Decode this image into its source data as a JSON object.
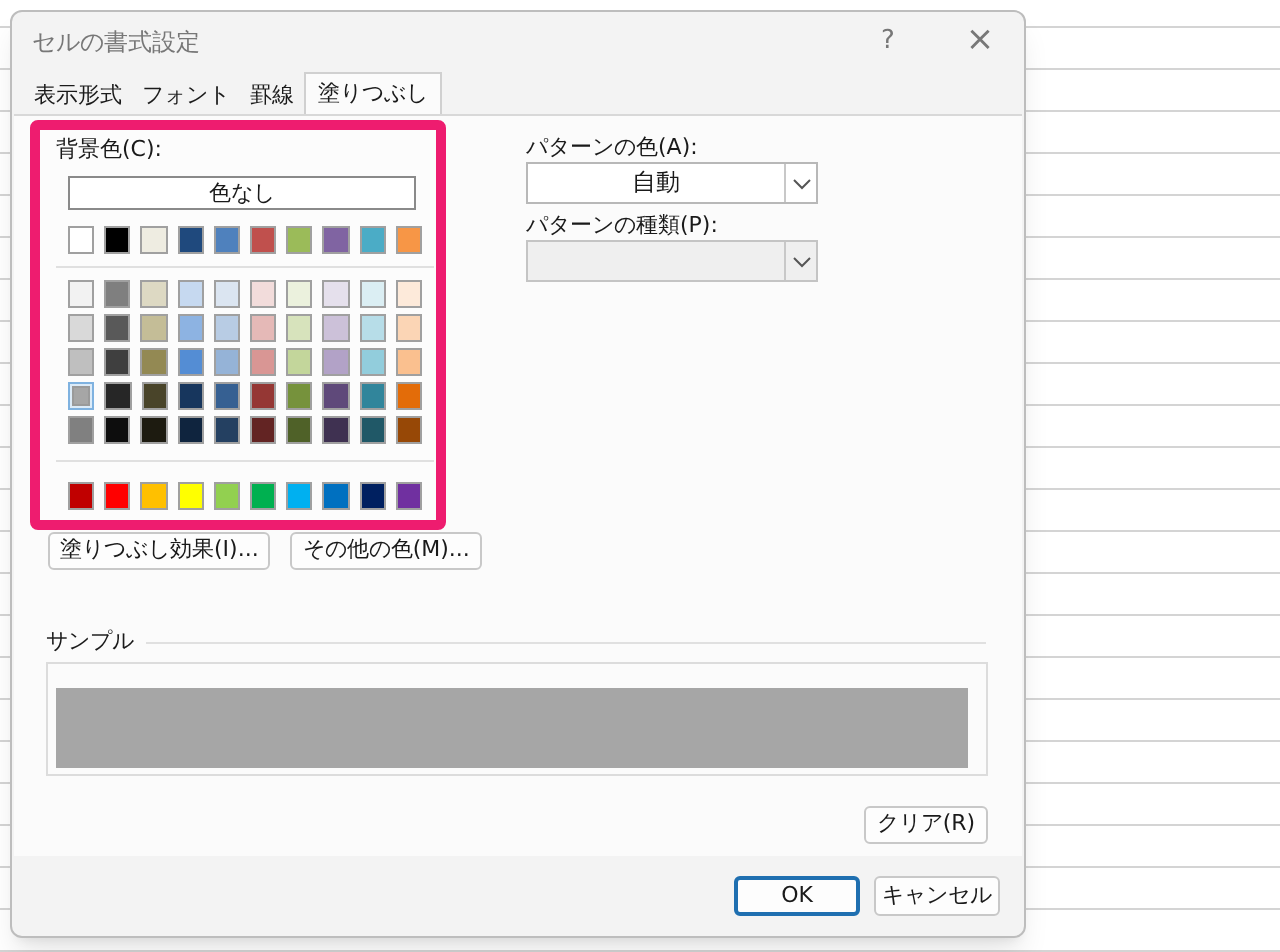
{
  "window": {
    "title": "セルの書式設定",
    "help": "?",
    "close": "×"
  },
  "tabs": [
    {
      "label": "表示形式",
      "selected": false
    },
    {
      "label": "フォント",
      "selected": false
    },
    {
      "label": "罫線",
      "selected": false
    },
    {
      "label": "塗りつぶし",
      "selected": true
    }
  ],
  "background_color": {
    "label": "背景色(C):",
    "no_color_button": "色なし",
    "theme_row": [
      {
        "color": "#ffffff",
        "selected": false
      },
      {
        "color": "#000000",
        "selected": false
      },
      {
        "color": "#eeece1",
        "selected": false
      },
      {
        "color": "#1f497d",
        "selected": false
      },
      {
        "color": "#4f81bd",
        "selected": false
      },
      {
        "color": "#c0504d",
        "selected": false
      },
      {
        "color": "#9bbb59",
        "selected": false
      },
      {
        "color": "#8064a2",
        "selected": false
      },
      {
        "color": "#4bacc6",
        "selected": false
      },
      {
        "color": "#f79646",
        "selected": false
      }
    ],
    "tint_rows": [
      [
        {
          "color": "#f2f2f2",
          "selected": false
        },
        {
          "color": "#7f7f7f",
          "selected": false
        },
        {
          "color": "#ddd9c3",
          "selected": false
        },
        {
          "color": "#c6d9f0",
          "selected": false
        },
        {
          "color": "#dbe5f1",
          "selected": false
        },
        {
          "color": "#f2dcdb",
          "selected": false
        },
        {
          "color": "#ebf1dd",
          "selected": false
        },
        {
          "color": "#e5e0ec",
          "selected": false
        },
        {
          "color": "#dbeef3",
          "selected": false
        },
        {
          "color": "#fdeada",
          "selected": false
        }
      ],
      [
        {
          "color": "#d9d9d9",
          "selected": false
        },
        {
          "color": "#595959",
          "selected": false
        },
        {
          "color": "#c4bd97",
          "selected": false
        },
        {
          "color": "#8db3e2",
          "selected": false
        },
        {
          "color": "#b8cce4",
          "selected": false
        },
        {
          "color": "#e5b9b7",
          "selected": false
        },
        {
          "color": "#d7e3bc",
          "selected": false
        },
        {
          "color": "#ccc1d9",
          "selected": false
        },
        {
          "color": "#b7dde8",
          "selected": false
        },
        {
          "color": "#fbd5b5",
          "selected": false
        }
      ],
      [
        {
          "color": "#bfbfbf",
          "selected": false
        },
        {
          "color": "#3f3f3f",
          "selected": false
        },
        {
          "color": "#938953",
          "selected": false
        },
        {
          "color": "#548dd4",
          "selected": false
        },
        {
          "color": "#95b3d7",
          "selected": false
        },
        {
          "color": "#d99694",
          "selected": false
        },
        {
          "color": "#c3d69b",
          "selected": false
        },
        {
          "color": "#b2a2c7",
          "selected": false
        },
        {
          "color": "#92cddc",
          "selected": false
        },
        {
          "color": "#fac08f",
          "selected": false
        }
      ],
      [
        {
          "color": "#a6a6a6",
          "selected": true
        },
        {
          "color": "#262626",
          "selected": false
        },
        {
          "color": "#494429",
          "selected": false
        },
        {
          "color": "#17365d",
          "selected": false
        },
        {
          "color": "#366092",
          "selected": false
        },
        {
          "color": "#953734",
          "selected": false
        },
        {
          "color": "#76923c",
          "selected": false
        },
        {
          "color": "#5f497a",
          "selected": false
        },
        {
          "color": "#31859b",
          "selected": false
        },
        {
          "color": "#e36c09",
          "selected": false
        }
      ],
      [
        {
          "color": "#808080",
          "selected": false
        },
        {
          "color": "#0d0d0d",
          "selected": false
        },
        {
          "color": "#1d1b10",
          "selected": false
        },
        {
          "color": "#0f243e",
          "selected": false
        },
        {
          "color": "#244061",
          "selected": false
        },
        {
          "color": "#632423",
          "selected": false
        },
        {
          "color": "#4f6128",
          "selected": false
        },
        {
          "color": "#3f3151",
          "selected": false
        },
        {
          "color": "#205867",
          "selected": false
        },
        {
          "color": "#974806",
          "selected": false
        }
      ]
    ],
    "standard_row": [
      {
        "color": "#c00000",
        "selected": false
      },
      {
        "color": "#ff0000",
        "selected": false
      },
      {
        "color": "#ffc000",
        "selected": false
      },
      {
        "color": "#ffff00",
        "selected": false
      },
      {
        "color": "#92d050",
        "selected": false
      },
      {
        "color": "#00b050",
        "selected": false
      },
      {
        "color": "#00b0f0",
        "selected": false
      },
      {
        "color": "#0070c0",
        "selected": false
      },
      {
        "color": "#002060",
        "selected": false
      },
      {
        "color": "#7030a0",
        "selected": false
      }
    ]
  },
  "fill_effects_button": "塗りつぶし効果(I)...",
  "more_colors_button": "その他の色(M)...",
  "pattern_color": {
    "label": "パターンの色(A):",
    "value": "自動"
  },
  "pattern_style": {
    "label": "パターンの種類(P):",
    "disabled": true
  },
  "sample": {
    "label": "サンプル"
  },
  "clear_button": "クリア(R)",
  "buttons": [
    {
      "label": "OK",
      "default": true
    },
    {
      "label": "キャンセル",
      "default": false
    }
  ]
}
